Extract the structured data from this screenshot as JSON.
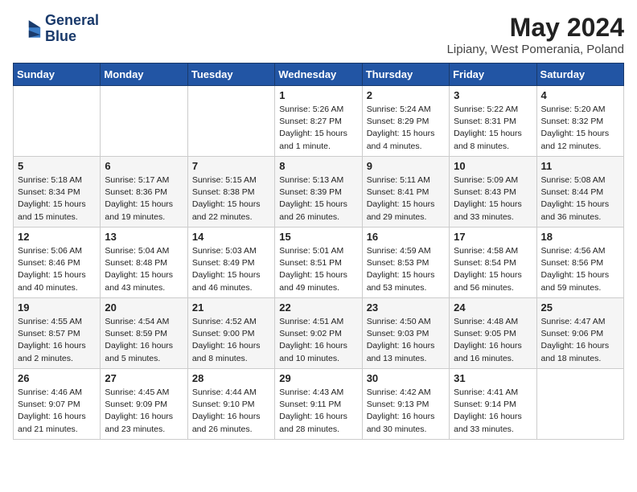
{
  "header": {
    "logo_line1": "General",
    "logo_line2": "Blue",
    "month": "May 2024",
    "location": "Lipiany, West Pomerania, Poland"
  },
  "days_of_week": [
    "Sunday",
    "Monday",
    "Tuesday",
    "Wednesday",
    "Thursday",
    "Friday",
    "Saturday"
  ],
  "weeks": [
    [
      {
        "day": "",
        "text": ""
      },
      {
        "day": "",
        "text": ""
      },
      {
        "day": "",
        "text": ""
      },
      {
        "day": "1",
        "text": "Sunrise: 5:26 AM\nSunset: 8:27 PM\nDaylight: 15 hours\nand 1 minute."
      },
      {
        "day": "2",
        "text": "Sunrise: 5:24 AM\nSunset: 8:29 PM\nDaylight: 15 hours\nand 4 minutes."
      },
      {
        "day": "3",
        "text": "Sunrise: 5:22 AM\nSunset: 8:31 PM\nDaylight: 15 hours\nand 8 minutes."
      },
      {
        "day": "4",
        "text": "Sunrise: 5:20 AM\nSunset: 8:32 PM\nDaylight: 15 hours\nand 12 minutes."
      }
    ],
    [
      {
        "day": "5",
        "text": "Sunrise: 5:18 AM\nSunset: 8:34 PM\nDaylight: 15 hours\nand 15 minutes."
      },
      {
        "day": "6",
        "text": "Sunrise: 5:17 AM\nSunset: 8:36 PM\nDaylight: 15 hours\nand 19 minutes."
      },
      {
        "day": "7",
        "text": "Sunrise: 5:15 AM\nSunset: 8:38 PM\nDaylight: 15 hours\nand 22 minutes."
      },
      {
        "day": "8",
        "text": "Sunrise: 5:13 AM\nSunset: 8:39 PM\nDaylight: 15 hours\nand 26 minutes."
      },
      {
        "day": "9",
        "text": "Sunrise: 5:11 AM\nSunset: 8:41 PM\nDaylight: 15 hours\nand 29 minutes."
      },
      {
        "day": "10",
        "text": "Sunrise: 5:09 AM\nSunset: 8:43 PM\nDaylight: 15 hours\nand 33 minutes."
      },
      {
        "day": "11",
        "text": "Sunrise: 5:08 AM\nSunset: 8:44 PM\nDaylight: 15 hours\nand 36 minutes."
      }
    ],
    [
      {
        "day": "12",
        "text": "Sunrise: 5:06 AM\nSunset: 8:46 PM\nDaylight: 15 hours\nand 40 minutes."
      },
      {
        "day": "13",
        "text": "Sunrise: 5:04 AM\nSunset: 8:48 PM\nDaylight: 15 hours\nand 43 minutes."
      },
      {
        "day": "14",
        "text": "Sunrise: 5:03 AM\nSunset: 8:49 PM\nDaylight: 15 hours\nand 46 minutes."
      },
      {
        "day": "15",
        "text": "Sunrise: 5:01 AM\nSunset: 8:51 PM\nDaylight: 15 hours\nand 49 minutes."
      },
      {
        "day": "16",
        "text": "Sunrise: 4:59 AM\nSunset: 8:53 PM\nDaylight: 15 hours\nand 53 minutes."
      },
      {
        "day": "17",
        "text": "Sunrise: 4:58 AM\nSunset: 8:54 PM\nDaylight: 15 hours\nand 56 minutes."
      },
      {
        "day": "18",
        "text": "Sunrise: 4:56 AM\nSunset: 8:56 PM\nDaylight: 15 hours\nand 59 minutes."
      }
    ],
    [
      {
        "day": "19",
        "text": "Sunrise: 4:55 AM\nSunset: 8:57 PM\nDaylight: 16 hours\nand 2 minutes."
      },
      {
        "day": "20",
        "text": "Sunrise: 4:54 AM\nSunset: 8:59 PM\nDaylight: 16 hours\nand 5 minutes."
      },
      {
        "day": "21",
        "text": "Sunrise: 4:52 AM\nSunset: 9:00 PM\nDaylight: 16 hours\nand 8 minutes."
      },
      {
        "day": "22",
        "text": "Sunrise: 4:51 AM\nSunset: 9:02 PM\nDaylight: 16 hours\nand 10 minutes."
      },
      {
        "day": "23",
        "text": "Sunrise: 4:50 AM\nSunset: 9:03 PM\nDaylight: 16 hours\nand 13 minutes."
      },
      {
        "day": "24",
        "text": "Sunrise: 4:48 AM\nSunset: 9:05 PM\nDaylight: 16 hours\nand 16 minutes."
      },
      {
        "day": "25",
        "text": "Sunrise: 4:47 AM\nSunset: 9:06 PM\nDaylight: 16 hours\nand 18 minutes."
      }
    ],
    [
      {
        "day": "26",
        "text": "Sunrise: 4:46 AM\nSunset: 9:07 PM\nDaylight: 16 hours\nand 21 minutes."
      },
      {
        "day": "27",
        "text": "Sunrise: 4:45 AM\nSunset: 9:09 PM\nDaylight: 16 hours\nand 23 minutes."
      },
      {
        "day": "28",
        "text": "Sunrise: 4:44 AM\nSunset: 9:10 PM\nDaylight: 16 hours\nand 26 minutes."
      },
      {
        "day": "29",
        "text": "Sunrise: 4:43 AM\nSunset: 9:11 PM\nDaylight: 16 hours\nand 28 minutes."
      },
      {
        "day": "30",
        "text": "Sunrise: 4:42 AM\nSunset: 9:13 PM\nDaylight: 16 hours\nand 30 minutes."
      },
      {
        "day": "31",
        "text": "Sunrise: 4:41 AM\nSunset: 9:14 PM\nDaylight: 16 hours\nand 33 minutes."
      },
      {
        "day": "",
        "text": ""
      }
    ]
  ]
}
